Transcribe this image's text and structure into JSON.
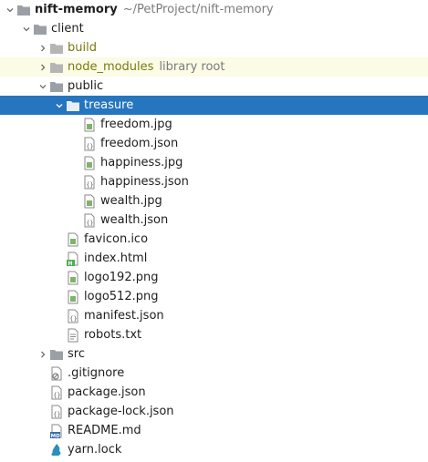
{
  "tree": {
    "root": {
      "label": "nift-memory",
      "path_hint": "~/PetProject/nift-memory"
    },
    "client": {
      "label": "client"
    },
    "build": {
      "label": "build"
    },
    "node_modules": {
      "label": "node_modules",
      "hint": "library root"
    },
    "public": {
      "label": "public"
    },
    "treasure": {
      "label": "treasure"
    },
    "treasure_files": [
      {
        "label": "freedom.jpg",
        "icon": "image-file-icon"
      },
      {
        "label": "freedom.json",
        "icon": "json-file-icon"
      },
      {
        "label": "happiness.jpg",
        "icon": "image-file-icon"
      },
      {
        "label": "happiness.json",
        "icon": "json-file-icon"
      },
      {
        "label": "wealth.jpg",
        "icon": "image-file-icon"
      },
      {
        "label": "wealth.json",
        "icon": "json-file-icon"
      }
    ],
    "public_files": [
      {
        "label": "favicon.ico",
        "icon": "image-file-icon"
      },
      {
        "label": "index.html",
        "icon": "html-file-icon"
      },
      {
        "label": "logo192.png",
        "icon": "image-file-icon"
      },
      {
        "label": "logo512.png",
        "icon": "image-file-icon"
      },
      {
        "label": "manifest.json",
        "icon": "json-file-icon"
      },
      {
        "label": "robots.txt",
        "icon": "text-file-icon"
      }
    ],
    "src": {
      "label": "src"
    },
    "client_files": [
      {
        "label": ".gitignore",
        "icon": "gitignore-file-icon"
      },
      {
        "label": "package.json",
        "icon": "json-file-icon"
      },
      {
        "label": "package-lock.json",
        "icon": "json-file-icon"
      },
      {
        "label": "README.md",
        "icon": "markdown-file-icon"
      },
      {
        "label": "yarn.lock",
        "icon": "yarn-file-icon"
      }
    ]
  }
}
